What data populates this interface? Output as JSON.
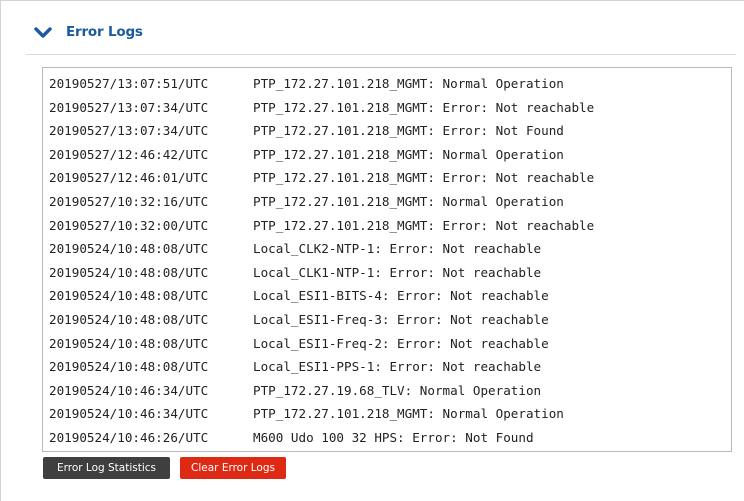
{
  "header": {
    "title": "Error Logs",
    "icon": "chevron-down-icon",
    "accent_color": "#1a5aa0"
  },
  "logs": [
    {
      "time": "20190527/13:07:51/UTC",
      "message": "PTP_172.27.101.218_MGMT: Normal Operation"
    },
    {
      "time": "20190527/13:07:34/UTC",
      "message": "PTP_172.27.101.218_MGMT: Error: Not reachable"
    },
    {
      "time": "20190527/13:07:34/UTC",
      "message": "PTP_172.27.101.218_MGMT: Error: Not Found"
    },
    {
      "time": "20190527/12:46:42/UTC",
      "message": "PTP_172.27.101.218_MGMT: Normal Operation"
    },
    {
      "time": "20190527/12:46:01/UTC",
      "message": "PTP_172.27.101.218_MGMT: Error: Not reachable"
    },
    {
      "time": "20190527/10:32:16/UTC",
      "message": "PTP_172.27.101.218_MGMT: Normal Operation"
    },
    {
      "time": "20190527/10:32:00/UTC",
      "message": "PTP_172.27.101.218_MGMT: Error: Not reachable"
    },
    {
      "time": "20190524/10:48:08/UTC",
      "message": "Local_CLK2-NTP-1: Error: Not reachable"
    },
    {
      "time": "20190524/10:48:08/UTC",
      "message": "Local_CLK1-NTP-1: Error: Not reachable"
    },
    {
      "time": "20190524/10:48:08/UTC",
      "message": "Local_ESI1-BITS-4: Error: Not reachable"
    },
    {
      "time": "20190524/10:48:08/UTC",
      "message": "Local_ESI1-Freq-3: Error: Not reachable"
    },
    {
      "time": "20190524/10:48:08/UTC",
      "message": "Local_ESI1-Freq-2: Error: Not reachable"
    },
    {
      "time": "20190524/10:48:08/UTC",
      "message": "Local_ESI1-PPS-1: Error: Not reachable"
    },
    {
      "time": "20190524/10:46:34/UTC",
      "message": "PTP_172.27.19.68_TLV: Normal Operation"
    },
    {
      "time": "20190524/10:46:34/UTC",
      "message": "PTP_172.27.101.218_MGMT: Normal Operation"
    },
    {
      "time": "20190524/10:46:26/UTC",
      "message": "M600 Udo 100 32 HPS: Error: Not Found"
    }
  ],
  "buttons": {
    "stats_label": "Error Log Statistics",
    "stats_color": "#3f3f3f",
    "clear_label": "Clear Error Logs",
    "clear_color": "#de2a14"
  }
}
